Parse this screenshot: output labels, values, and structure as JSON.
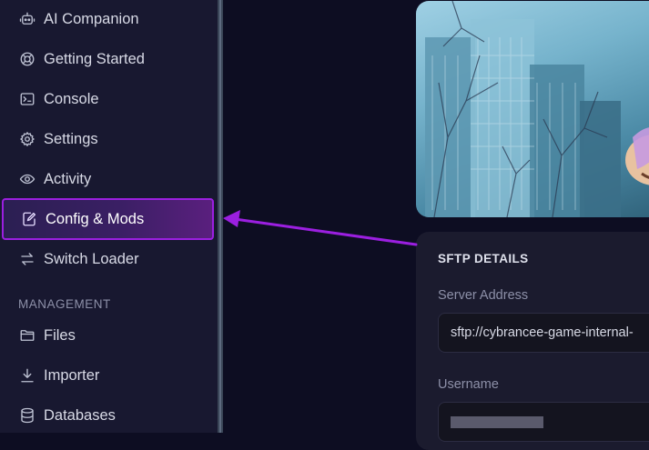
{
  "sidebar": {
    "items": [
      {
        "label": "AI Companion",
        "icon": "robot-icon"
      },
      {
        "label": "Getting Started",
        "icon": "lifebuoy-icon"
      },
      {
        "label": "Console",
        "icon": "terminal-icon"
      },
      {
        "label": "Settings",
        "icon": "gear-icon"
      },
      {
        "label": "Activity",
        "icon": "eye-icon"
      },
      {
        "label": "Config & Mods",
        "icon": "file-edit-icon",
        "active": true
      },
      {
        "label": "Switch Loader",
        "icon": "swap-arrows-icon"
      }
    ],
    "section_label": "MANAGEMENT",
    "management_items": [
      {
        "label": "Files",
        "icon": "folder-icon"
      },
      {
        "label": "Importer",
        "icon": "download-icon"
      },
      {
        "label": "Databases",
        "icon": "database-icon"
      }
    ]
  },
  "sftp": {
    "title": "SFTP DETAILS",
    "server_address_label": "Server Address",
    "server_address_value": "sftp://cybrancee-game-internal-",
    "username_label": "Username"
  },
  "colors": {
    "accent": "#9b1fe0",
    "background": "#0d0d22",
    "sidebar": "#181830",
    "card": "#1b1b2e"
  }
}
